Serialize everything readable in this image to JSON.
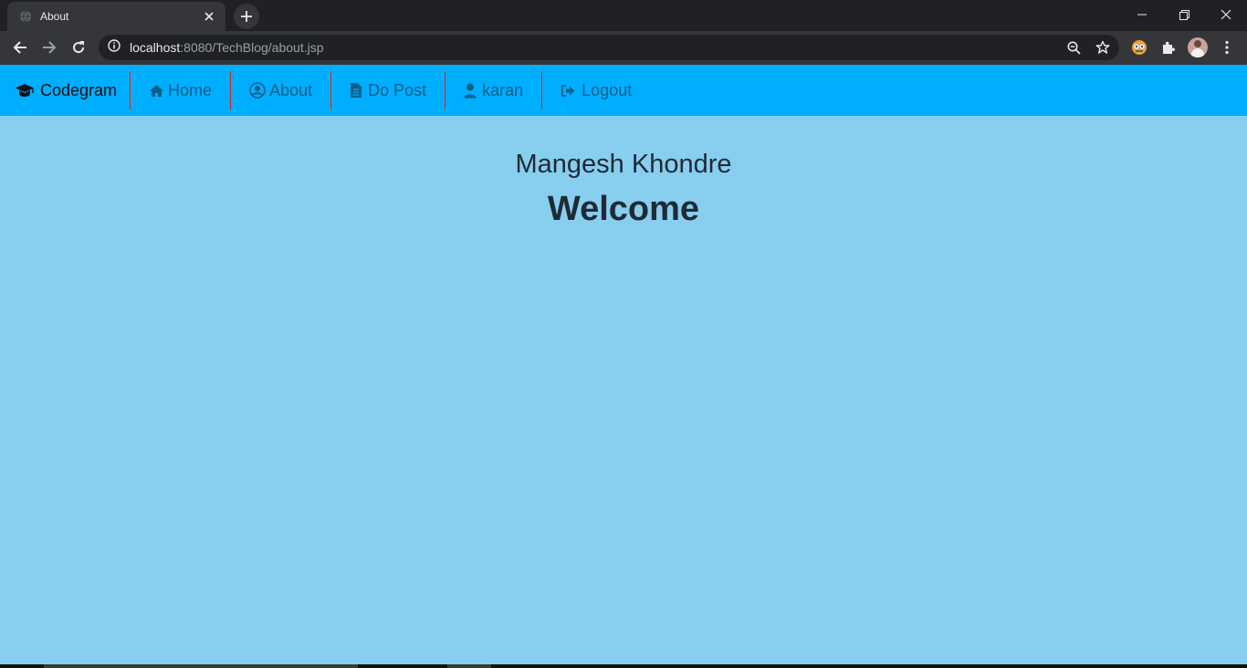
{
  "browser": {
    "tab_title": "About",
    "url_host": "localhost",
    "url_rest": ":8080/TechBlog/about.jsp"
  },
  "navbar": {
    "brand": "Codegram",
    "links": [
      {
        "label": "Home",
        "icon": "home-icon"
      },
      {
        "label": "About",
        "icon": "user-circle-icon"
      },
      {
        "label": "Do Post",
        "icon": "file-icon"
      },
      {
        "label": "karan",
        "icon": "user-icon"
      },
      {
        "label": "Logout",
        "icon": "sign-out-icon"
      }
    ],
    "bg_color": "#00aeff",
    "divider_color": "#e0241c"
  },
  "content": {
    "name": "Mangesh Khondre",
    "heading": "Welcome",
    "bg_color": "#87ceef"
  }
}
